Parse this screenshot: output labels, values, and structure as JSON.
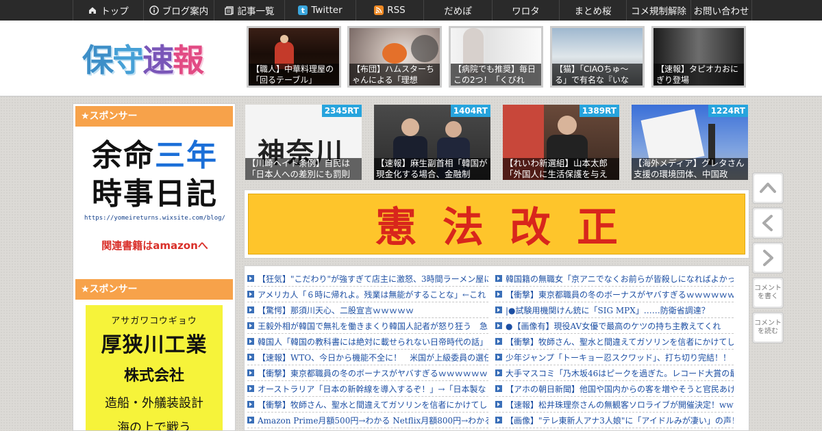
{
  "nav": [
    {
      "label": "トップ",
      "icon": "home-icon"
    },
    {
      "label": "ブログ案内",
      "icon": "info-icon"
    },
    {
      "label": "記事一覧",
      "icon": "list-icon"
    },
    {
      "label": "Twitter",
      "icon": "twitter-icon"
    },
    {
      "label": "RSS",
      "icon": "rss-icon"
    },
    {
      "label": "だめぽ"
    },
    {
      "label": "ワロタ"
    },
    {
      "label": "まとめ桜"
    },
    {
      "label": "コメ規制解除"
    },
    {
      "label": "お問い合わせ"
    }
  ],
  "logo": {
    "chars": [
      "保",
      "守",
      "速",
      "報"
    ]
  },
  "header_articles": [
    {
      "caption": "【職人】中華料理屋の「回るテーブル」"
    },
    {
      "caption": "【布団】ハムスターちゃんによる「理想"
    },
    {
      "caption": "【病院でも推奨】毎日この2つ！「くびれ"
    },
    {
      "caption": "【猫】「CIAOちゅ〜る」で有名な『いな"
    },
    {
      "caption": "【速報】タピオカおにぎり登場"
    }
  ],
  "sidebar": {
    "sponsor_label_1": "★スポンサー",
    "sponsor_label_2": "★スポンサー",
    "ad1": {
      "line1_a": "余命",
      "line1_b": "三年",
      "line2": "時事日記",
      "url": "https://yomeireturns.wixsite.com/blog/",
      "link": "関連書籍はamazonへ"
    },
    "ad2": {
      "kana": "アサガワコウギョウ",
      "name": "厚狭川工業",
      "kk": "株式会社",
      "desc": "造船・外艤装設計",
      "last": "海の上で戦う"
    }
  },
  "featured": [
    {
      "rt": "2345RT",
      "caption": "【川崎ヘイト条例】自民は「日本人への差別にも罰則"
    },
    {
      "rt": "1404RT",
      "caption": "【速報】麻生副首相「韓国が現金化する場合、金融制"
    },
    {
      "rt": "1389RT",
      "caption": "【れいわ新選組】山本太郎「外国人に生活保護を与え"
    },
    {
      "rt": "1224RT",
      "caption": "【海外メディア】グレタさん支援の環境団体、中国政"
    }
  ],
  "banner": {
    "text": "憲法改正"
  },
  "news_left": [
    "【狂気】\"こだわり\"が強すぎて店主に激怒、3時間ラーメン屋に",
    "アメリカ人「６時に帰れよ。残業は無能がすることな」←これ",
    "【驚愕】那須川天心、二股宣言ｗｗｗｗｗ",
    "王毅外相が韓国で無礼を働きまくり韓国人記者が怒り狂う　急",
    "韓国人「韓国の教科書には絶対に載せられない日帝時代の話」",
    "【速報】WTO、今日から機能不全に！　米国が上級委員の選任",
    "【衝撃】東京都職員の冬のボーナスがヤバすぎるｗｗｗｗｗｗ",
    "オーストラリア「日本の新幹線を導入するぞ！」→「日本製な",
    "【衝撃】牧師さん、聖水と間違えてガソリンを信者にかけてし",
    "Amazon Prime月額500円→わかる Netflix月額800円→わかる NHK"
  ],
  "news_right": [
    "韓国籍の無職女「京アニでなくお前らが皆殺しになればよかっ",
    "【衝撃】東京都職員の冬のボーナスがヤバすぎるｗｗｗｗｗｗ",
    "|●試験用機関けん銃に「SIG MPX」……防衛省調達？",
    "●【画像有】現役AV女優で最高のケツの持ち主教えてくれ",
    "【衝撃】牧師さん、聖水と間違えてガソリンを信者にかけてし",
    "少年ジャンプ「トーキョー忍スクワッド」、打ち切り完結！！",
    "大手マスコミ「乃木坂46はピークを過ぎた。レコード大賞の最",
    "【アホの朝日新聞】他国や国内からの客を増やそうと官民あげ",
    "【速報】松井珠理奈さんの無観客ソロライブが開催決定！www",
    "【画像】\"テレ東新人アナ3人娘\"に「アイドルみが凄い」の声！"
  ],
  "float_buttons": {
    "comment_write": "コメントを書く",
    "comment_read": "コメントを読む"
  },
  "colors": {
    "accent_orange": "#f7a24a",
    "rt_blue": "#27a4dd",
    "link_blue": "#1d4fa3",
    "banner_yellow": "#fec52b",
    "banner_red": "#d8261c"
  }
}
